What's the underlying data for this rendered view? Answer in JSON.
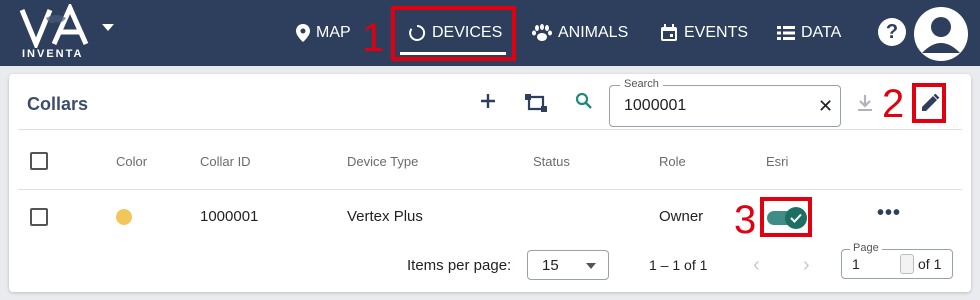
{
  "app": {
    "logo_text": "INVENTA"
  },
  "nav": {
    "map": "MAP",
    "devices": "DEVICES",
    "animals": "ANIMALS",
    "events": "EVENTS",
    "data": "DATA",
    "help": "?"
  },
  "annotations": {
    "one": "1",
    "two": "2",
    "three": "3",
    "color": "#e00010"
  },
  "card": {
    "title": "Collars",
    "search_label": "Search",
    "search_value": "1000001"
  },
  "table": {
    "headers": {
      "color": "Color",
      "collar_id": "Collar ID",
      "device_type": "Device Type",
      "status": "Status",
      "role": "Role",
      "esri": "Esri"
    },
    "rows": [
      {
        "color": "#f1c75b",
        "collar_id": "1000001",
        "device_type": "Vertex Plus",
        "status": "",
        "role": "Owner",
        "esri": true,
        "more": "•••"
      }
    ]
  },
  "pagination": {
    "items_per_page_label": "Items per page:",
    "items_per_page": "15",
    "range": "1 – 1 of 1",
    "page_label": "Page",
    "page_value": "1",
    "of_total": "of 1"
  },
  "colors": {
    "topbar": "#2d3f5c",
    "accent": "#1d6e63",
    "title": "#3e4e6a"
  }
}
